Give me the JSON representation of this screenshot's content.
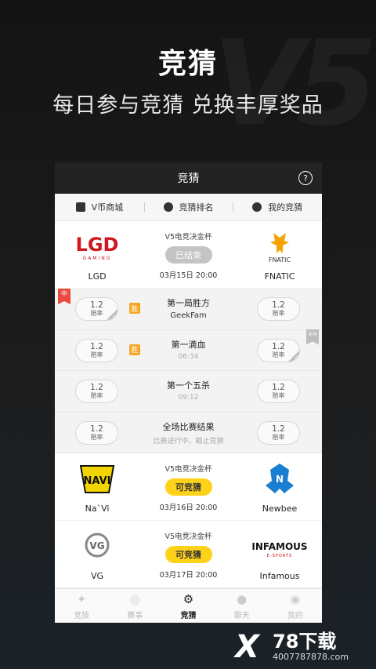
{
  "hero": {
    "bg_mark": "V5",
    "title": "竞猜",
    "subtitle": "每日参与竞猜 兑换丰厚奖品"
  },
  "appbar": {
    "title": "竞猜",
    "help_icon": "?"
  },
  "subnav": [
    {
      "label": "V币商城",
      "icon": "store-icon"
    },
    {
      "label": "竞猜排名",
      "icon": "ranking-icon"
    },
    {
      "label": "我的竞猜",
      "icon": "user-icon"
    }
  ],
  "matches": [
    {
      "league": "V5电竞决金杯",
      "status": "已结束",
      "time": "03月15日 20:00",
      "left_team": {
        "name": "LGD",
        "logo_text": "LGD",
        "logo_sub": "GAMING"
      },
      "right_team": {
        "name": "FNATIC",
        "logo_text": "FNATIC"
      }
    },
    {
      "league": "V5电竞决金杯",
      "status": "可竞猜",
      "time": "03月16日 20:00",
      "left_team": {
        "name": "Na`Vi",
        "logo_text": "NAVI"
      },
      "right_team": {
        "name": "Newbee",
        "logo_text": "N"
      }
    },
    {
      "league": "V5电竞决金杯",
      "status": "可竞猜",
      "time": "03月17日 20:00",
      "left_team": {
        "name": "VG",
        "logo_text": "VG"
      },
      "right_team": {
        "name": "Infamous",
        "logo_text": "INFAMOUS",
        "logo_sub": "E-SPORTS"
      }
    }
  ],
  "bets": [
    {
      "title": "第一局胜方",
      "subtitle": "GeekFam",
      "left_odds": "1.2",
      "right_odds": "1.2",
      "odds_label": "赔率",
      "badge": "胜",
      "ribbon": "中"
    },
    {
      "title": "第一滴血",
      "subtitle": "06:34",
      "left_odds": "1.2",
      "right_odds": "1.2",
      "odds_label": "赔率",
      "badge": "胜",
      "ribbon": "未中"
    },
    {
      "title": "第一个五杀",
      "subtitle": "09:12",
      "left_odds": "1.2",
      "right_odds": "1.2",
      "odds_label": "赔率"
    },
    {
      "title": "全场比赛结果",
      "subtitle": "比赛进行中，截止竞猜",
      "left_odds": "1.2",
      "right_odds": "1.2",
      "odds_label": "赔率"
    }
  ],
  "tabbar": [
    {
      "label": "竞技",
      "icon": "✦"
    },
    {
      "label": "赛事",
      "icon": "◎"
    },
    {
      "label": "竞猜",
      "icon": "⚙"
    },
    {
      "label": "聊天",
      "icon": "●"
    },
    {
      "label": "我的",
      "icon": "◉"
    }
  ],
  "watermark": {
    "mark": "X",
    "brand": "78下载",
    "url": "4007787878.com"
  }
}
